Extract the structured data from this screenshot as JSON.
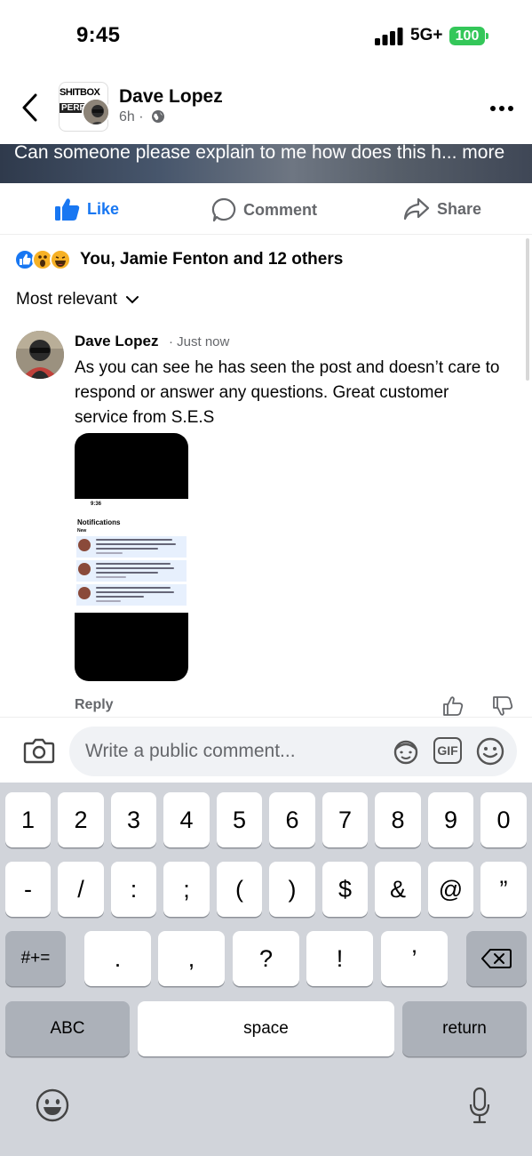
{
  "status_bar": {
    "time": "9:45",
    "network": "5G+",
    "battery": "100",
    "battery_color": "#34c759"
  },
  "header": {
    "page_logo_text_1": "SHITBOX",
    "page_logo_text_2": "PERFO",
    "author": "Dave Lopez",
    "meta": "6h ·",
    "back_icon": "chevron-left-icon",
    "more_icon": "more-horizontal-icon"
  },
  "post": {
    "caption": "Can someone please explain to me how does this h",
    "caption_more": "... more"
  },
  "actions": {
    "like": "Like",
    "comment": "Comment",
    "share": "Share",
    "like_color": "#1877f2"
  },
  "reactions": {
    "text": "You, Jamie Fenton and 12 others",
    "icons": [
      "like-icon",
      "wow-icon",
      "haha-icon"
    ]
  },
  "sort": {
    "label": "Most relevant"
  },
  "comment": {
    "author": "Dave Lopez",
    "time": "· Just now",
    "text": "As you can see he has seen the post and doesn’t care to respond or answer any questions. Great customer service from S.E.S",
    "reply_label": "Reply",
    "attachment": {
      "time": "9:36",
      "title": "Notifications",
      "section": "New"
    }
  },
  "composer": {
    "placeholder": "Write a public comment...",
    "gif_label": "GIF"
  },
  "keyboard": {
    "row1": [
      "1",
      "2",
      "3",
      "4",
      "5",
      "6",
      "7",
      "8",
      "9",
      "0"
    ],
    "row2": [
      "-",
      "/",
      ":",
      ";",
      "(",
      ")",
      "$",
      "&",
      "@",
      "”"
    ],
    "row3": [
      ".",
      ",",
      "?",
      "!",
      "’"
    ],
    "shift_label": "#+=",
    "abc_label": "ABC",
    "space_label": "space",
    "return_label": "return"
  }
}
